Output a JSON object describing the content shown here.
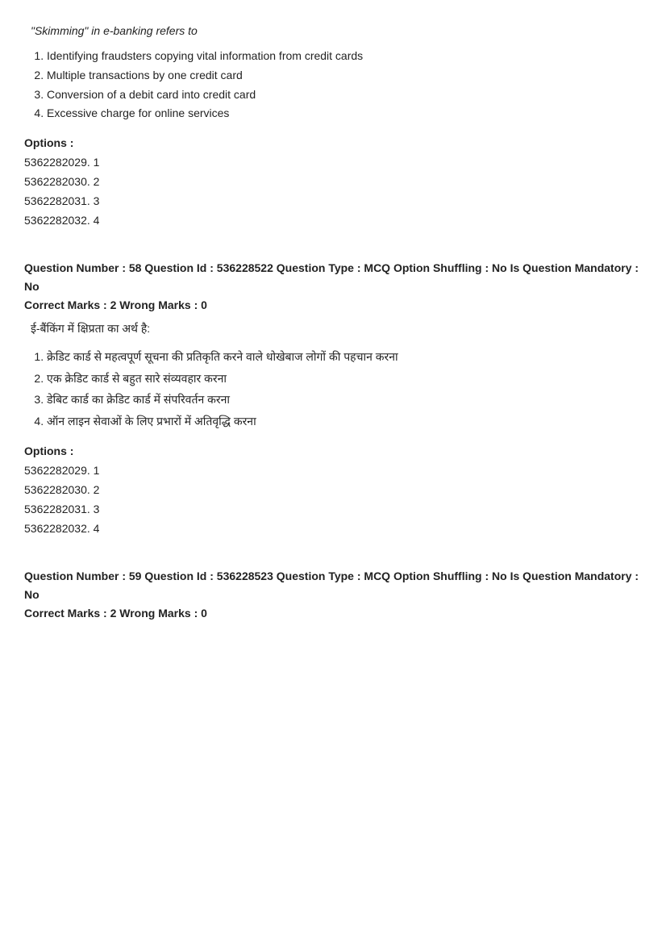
{
  "topSection": {
    "introText": "\"Skimming\" in e-banking refers to",
    "optionsList": [
      "Identifying fraudsters copying vital information from credit cards",
      "Multiple transactions by one credit card",
      "Conversion of a debit card into credit card",
      "Excessive charge for online services"
    ],
    "optionsLabel": "Options :",
    "options": [
      {
        "id": "5362282029",
        "value": "1"
      },
      {
        "id": "5362282030",
        "value": "2"
      },
      {
        "id": "5362282031",
        "value": "3"
      },
      {
        "id": "5362282032",
        "value": "4"
      }
    ]
  },
  "question58": {
    "meta": "Question Number : 58 Question Id : 536228522 Question Type : MCQ Option Shuffling : No Is Question Mandatory : No",
    "marks": "Correct Marks : 2 Wrong Marks : 0",
    "questionTextHindi": "ई-बैंकिंग में क्षिप्रता का अर्थ है:",
    "hindiOptionsList": [
      "क्रेडिट कार्ड से महत्वपूर्ण सूचना की प्रतिकृति करने वाले धोखेबाज लोगों की पहचान करना",
      "एक क्रेडिट कार्ड से बहुत सारे संव्यवहार करना",
      "डेबिट कार्ड का क्रेडिट कार्ड में संपरिवर्तन करना",
      "ऑन लाइन सेवाओं के लिए प्रभारों में अतिवृद्धि करना"
    ],
    "optionsLabel": "Options :",
    "options": [
      {
        "id": "5362282029",
        "value": "1"
      },
      {
        "id": "5362282030",
        "value": "2"
      },
      {
        "id": "5362282031",
        "value": "3"
      },
      {
        "id": "5362282032",
        "value": "4"
      }
    ]
  },
  "question59": {
    "meta": "Question Number : 59 Question Id : 536228523 Question Type : MCQ Option Shuffling : No Is Question Mandatory : No",
    "marks": "Correct Marks : 2 Wrong Marks : 0"
  }
}
